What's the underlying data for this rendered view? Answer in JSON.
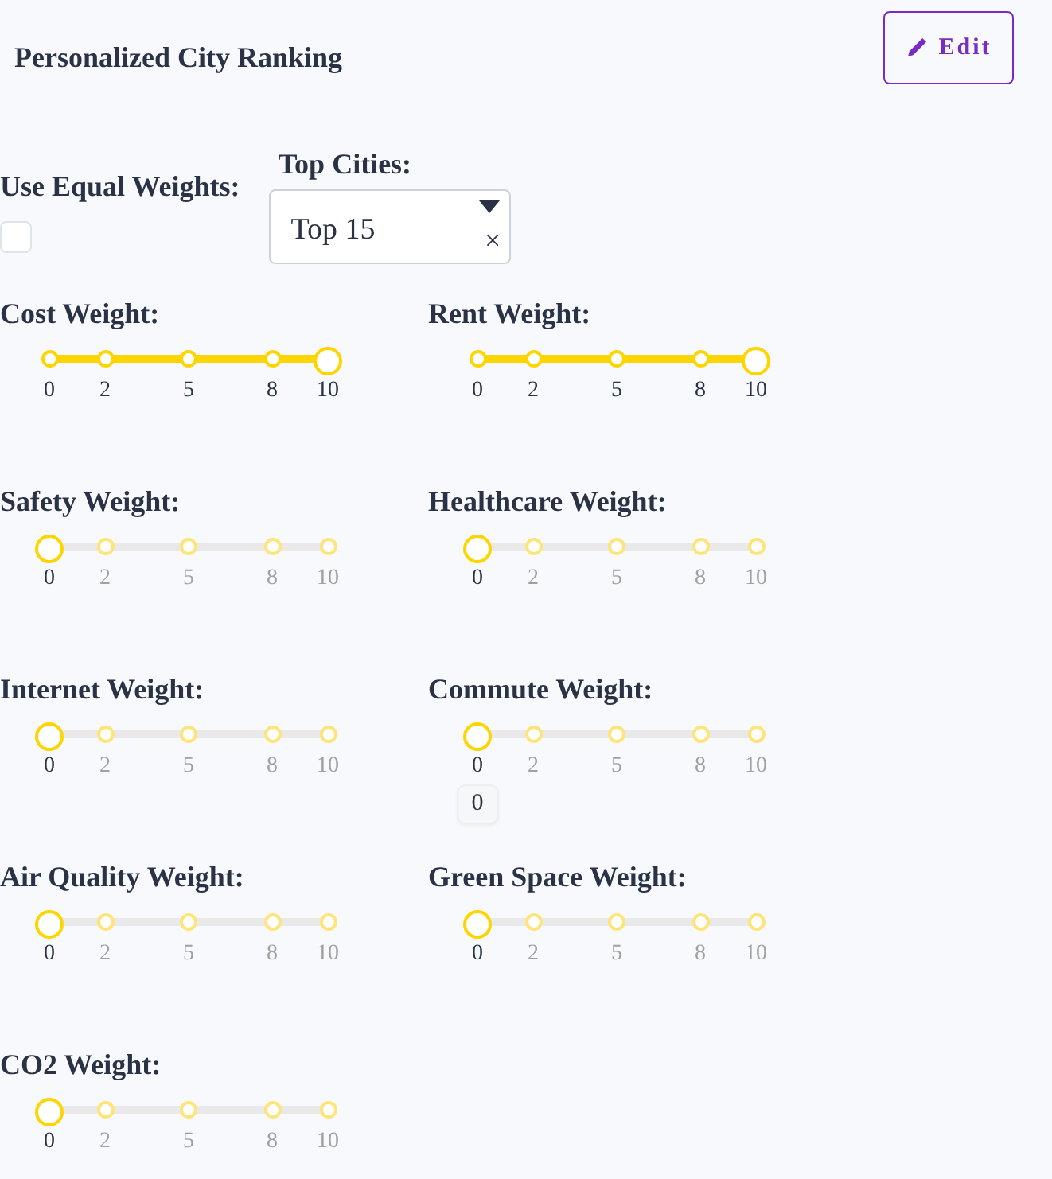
{
  "header": {
    "title": "Personalized City Ranking",
    "edit_button": "Edit"
  },
  "equal_weights": {
    "label": "Use Equal Weights:",
    "checked": false
  },
  "top_cities": {
    "label": "Top Cities:",
    "value": "Top 15",
    "clear": "×"
  },
  "sliders": [
    {
      "label": "Cost Weight:",
      "level": 1,
      "marks": [
        "0",
        "2",
        "5",
        "8",
        "10"
      ]
    },
    {
      "label": "Rent Weight:",
      "level": 1,
      "marks": [
        "0",
        "2",
        "5",
        "8",
        "10"
      ]
    },
    {
      "label": "Safety Weight:",
      "level": 0,
      "marks": [
        "0",
        "2",
        "5",
        "8",
        "10"
      ]
    },
    {
      "label": "Healthcare Weight:",
      "level": 0,
      "marks": [
        "0",
        "2",
        "5",
        "8",
        "10"
      ]
    },
    {
      "label": "Internet Weight:",
      "level": 0,
      "marks": [
        "0",
        "2",
        "5",
        "8",
        "10"
      ]
    },
    {
      "label": "Commute Weight:",
      "level": 0,
      "marks": [
        "0",
        "2",
        "5",
        "8",
        "10"
      ],
      "tooltip": "0"
    },
    {
      "label": "Air Quality Weight:",
      "level": 0,
      "marks": [
        "0",
        "2",
        "5",
        "8",
        "10"
      ]
    },
    {
      "label": "Green Space Weight:",
      "level": 0,
      "marks": [
        "0",
        "2",
        "5",
        "8",
        "10"
      ]
    },
    {
      "label": "CO2 Weight:",
      "level": 0,
      "marks": [
        "0",
        "2",
        "5",
        "8",
        "10"
      ]
    }
  ]
}
